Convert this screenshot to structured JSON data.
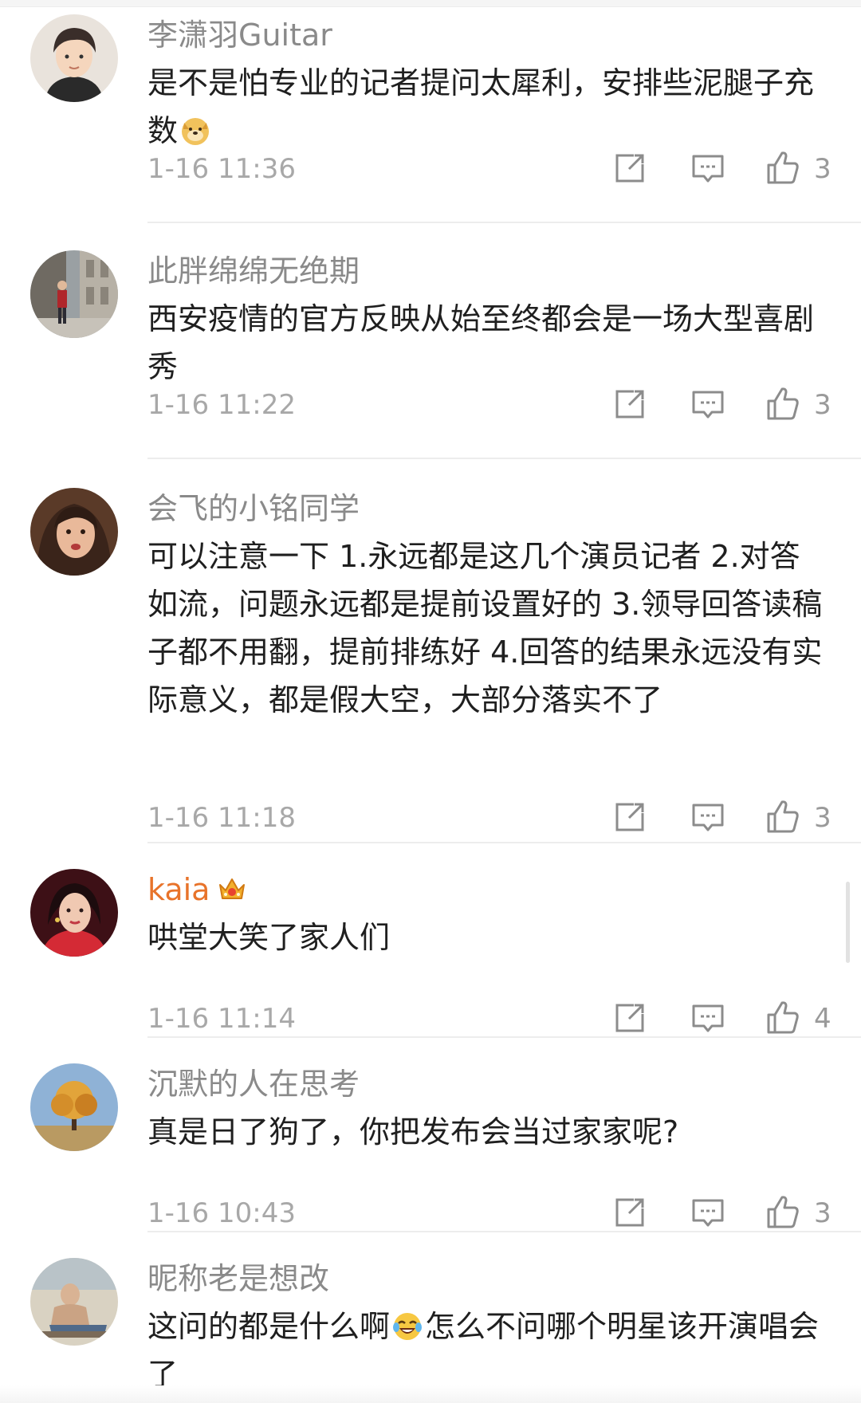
{
  "comments": [
    {
      "username": "李潇羽Guitar",
      "text_before_emoji": "是不是怕专业的记者提问太犀利，安排些泥腿子充数",
      "text_after_emoji": "",
      "emoji": "doge-emoji",
      "time": "1-16 11:36",
      "likes": "3",
      "avatar": "boy-portrait-avatar"
    },
    {
      "username": "此胖绵绵无绝期",
      "text_before_emoji": "西安疫情的官方反映从始至终都会是一场大型喜剧秀",
      "text_after_emoji": "",
      "emoji": "",
      "time": "1-16 11:22",
      "likes": "3",
      "avatar": "street-photo-avatar"
    },
    {
      "username": "会飞的小铭同学",
      "text_before_emoji": "可以注意一下 1.永远都是这几个演员记者 2.对答如流，问题永远都是提前设置好的 3.领导回答读稿子都不用翻，提前排练好 4.回答的结果永远没有实际意义，都是假大空，大部分落实不了",
      "text_after_emoji": "",
      "emoji": "",
      "time": "1-16 11:18",
      "likes": "3",
      "avatar": "woman-portrait-avatar"
    },
    {
      "username": "kaia",
      "username_vip": true,
      "badge": "crown-badge-icon",
      "text_before_emoji": "哄堂大笑了家人们",
      "text_after_emoji": "",
      "emoji": "",
      "time": "1-16 11:14",
      "likes": "4",
      "avatar": "red-outfit-portrait-avatar"
    },
    {
      "username": "沉默的人在思考",
      "text_before_emoji": "真是日了狗了，你把发布会当过家家呢?",
      "text_after_emoji": "",
      "emoji": "",
      "time": "1-16 10:43",
      "likes": "3",
      "avatar": "autumn-tree-avatar"
    },
    {
      "username": "昵称老是想改",
      "text_before_emoji": "这问的都是什么啊",
      "text_after_emoji": "怎么不问哪个明星该开演唱会了",
      "emoji": "laughing-tears-emoji",
      "time": "",
      "likes": "",
      "avatar": "man-lounging-avatar"
    }
  ],
  "actions": {
    "share_icon": "share-icon",
    "reply_icon": "comment-icon",
    "like_icon": "thumbs-up-icon"
  },
  "colors": {
    "username": "#8a8a8a",
    "vip_username": "#e8732a",
    "text": "#1f1f1f",
    "meta": "#a8a8a8"
  }
}
